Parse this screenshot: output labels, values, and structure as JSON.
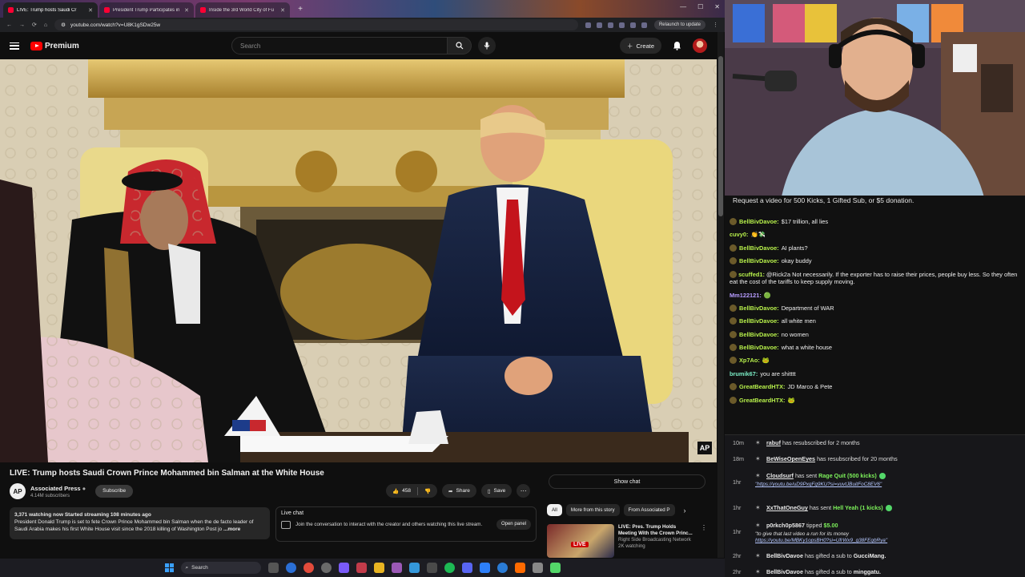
{
  "browser": {
    "tabs": [
      {
        "title": "LIVE: Trump hosts Saudi Cr",
        "active": true
      },
      {
        "title": "President Trump Participates in",
        "active": false
      },
      {
        "title": "Inside the 3rd World City of Fu",
        "active": false
      }
    ],
    "url": "youtube.com/watch?v=U8K1gSDw25w",
    "relaunch_label": "Relaunch to update"
  },
  "youtube": {
    "logo_text": "Premium",
    "search_placeholder": "Search",
    "create_label": "Create",
    "video_title": "LIVE: Trump hosts Saudi Crown Prince Mohammed bin Salman at the White House",
    "channel": {
      "name": "Associated Press",
      "subs": "4.14M subscribers",
      "avatar_text": "AP"
    },
    "subscribe_label": "Subscribe",
    "like_count": "458",
    "share_label": "Share",
    "save_label": "Save",
    "description": {
      "meta": "3,371 watching now  Started streaming 108 minutes ago",
      "text": "President Donald Trump is set to fete Crown Prince Mohammed bin Salman when the de facto leader of Saudi Arabia makes his first White House visit since the 2018 killing of Washington Post jo",
      "more": "...more"
    },
    "live_chat": {
      "title": "Live chat",
      "text": "Join the conversation to interact with the creator and others watching this live stream.",
      "open_panel": "Open panel"
    },
    "show_chat": "Show chat",
    "chips": [
      "All",
      "More from this story",
      "From Associated P"
    ],
    "recommendation": {
      "title": "LIVE: Pres. Trump Holds Meeting With the Crown Princ...",
      "channel": "Right Side Broadcasting Network",
      "watching": "2K watching",
      "badge": "LIVE"
    },
    "ap_watermark": "AP"
  },
  "taskbar": {
    "search_label": "Search"
  },
  "stream": {
    "banner": "Request a video for 500 Kicks, 1 Gifted Sub, or $5 donation.",
    "chat": [
      {
        "user": "BellBivDavoe",
        "text": "$17 trillion, all lies",
        "badge": true
      },
      {
        "user": "cuvy0",
        "text": "👏💸",
        "badge": false
      },
      {
        "user": "BellBivDavoe",
        "text": "AI plants?",
        "badge": true
      },
      {
        "user": "BellBivDavoe",
        "text": "okay buddy",
        "badge": true
      },
      {
        "user": "scuffed1",
        "text": "@Rick2a Not necessarily. If the exporter has to raise their prices, people buy less. So they often eat the cost of the tariffs to keep supply moving.",
        "badge": true
      },
      {
        "user": "Mm122121",
        "text": "🟢",
        "badge": false
      },
      {
        "user": "BellBivDavoe",
        "text": "Department of WAR",
        "badge": true
      },
      {
        "user": "BellBivDavoe",
        "text": "all white men",
        "badge": true
      },
      {
        "user": "BellBivDavoe",
        "text": "no women",
        "badge": true
      },
      {
        "user": "BellBivDavoe",
        "text": "what a white house",
        "badge": true
      },
      {
        "user": "Xp7Ao",
        "text": "🐸",
        "badge": true
      },
      {
        "user": "brumik67",
        "text": "you are shitttt",
        "badge": false
      },
      {
        "user": "GreatBeardHTX",
        "text": "JD Marco & Pete",
        "badge": true
      },
      {
        "user": "GreatBeardHTX",
        "text": "🐸",
        "badge": true
      }
    ],
    "events": [
      {
        "time": "10m",
        "name": "rabuf",
        "text": "has resubscribed for 2 months"
      },
      {
        "time": "18m",
        "name": "BeWiseOpenEyes",
        "text": "has resubscribed for 20 months"
      },
      {
        "time": "1hr",
        "name": "Cloudsurf",
        "text": "has sent",
        "highlight": "Rage Quit (500 kicks)",
        "sub": "\"https://youtu.be/uD9PxqFg9KU?si=vuvtJBuitFoC8EV6\""
      },
      {
        "time": "1hr",
        "name": "XxThatOneGuy",
        "text": "has sent",
        "highlight": "Hell Yeah (1 kicks)"
      },
      {
        "time": "1hr",
        "name": "p0rkch0p5867",
        "text": "tipped",
        "highlight": "$5.00",
        "sub": "\"to give that last video a run for its money",
        "sub2": "https://youtu.be/MBKy1opsBH0?si=UfrWx9_g38FEqbRya\""
      },
      {
        "time": "2hr",
        "name": "BellBivDavoe",
        "text": "has gifted a sub to",
        "target": "GucciMang."
      },
      {
        "time": "2hr",
        "name": "BellBivDavoe",
        "text": "has gifted a sub to",
        "target": "minggatu."
      }
    ]
  },
  "colors": {
    "youtube_red": "#ff0000",
    "chat_username": "#b7f04b",
    "kick_green": "#53d769"
  }
}
